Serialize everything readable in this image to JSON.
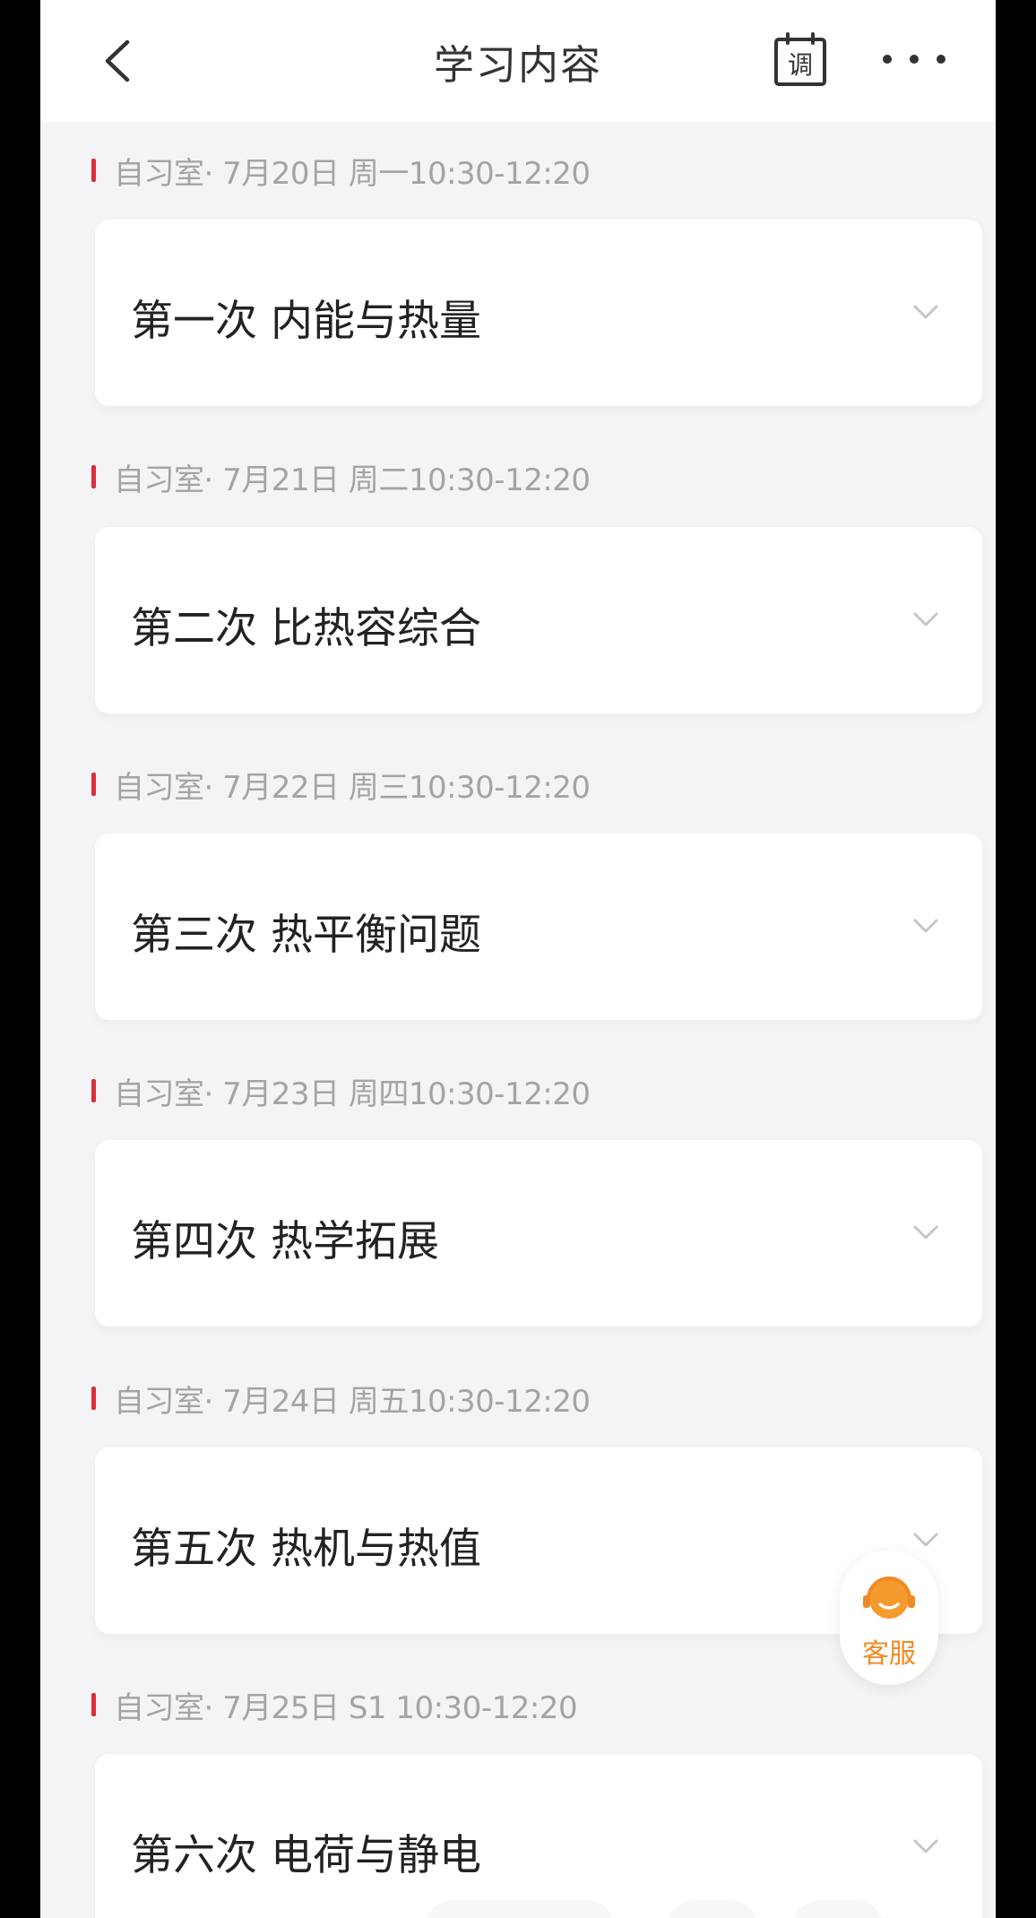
{
  "header": {
    "title": "学习内容",
    "schedule_icon_char": "调",
    "back_icon": "chevron-left-icon",
    "more_icon": "more-horizontal-icon"
  },
  "sessions": [
    {
      "header": "自习室· 7月20日 周一10:30-12:20",
      "title": "第一次  内能与热量"
    },
    {
      "header": "自习室· 7月21日 周二10:30-12:20",
      "title": "第二次  比热容综合"
    },
    {
      "header": "自习室· 7月22日 周三10:30-12:20",
      "title": "第三次  热平衡问题"
    },
    {
      "header": "自习室· 7月23日 周四10:30-12:20",
      "title": "第四次  热学拓展"
    },
    {
      "header": "自习室· 7月24日 周五10:30-12:20",
      "title": "第五次  热机与热值"
    },
    {
      "header": "自习室· 7月25日 S1 10:30-12:20",
      "title": "第六次  电荷与静电"
    }
  ],
  "customer_service": {
    "label": "客服",
    "icon": "headset-icon"
  },
  "colors": {
    "accent_red": "#d8303a",
    "service_orange": "#f08a24",
    "background": "#f4f4f6"
  }
}
